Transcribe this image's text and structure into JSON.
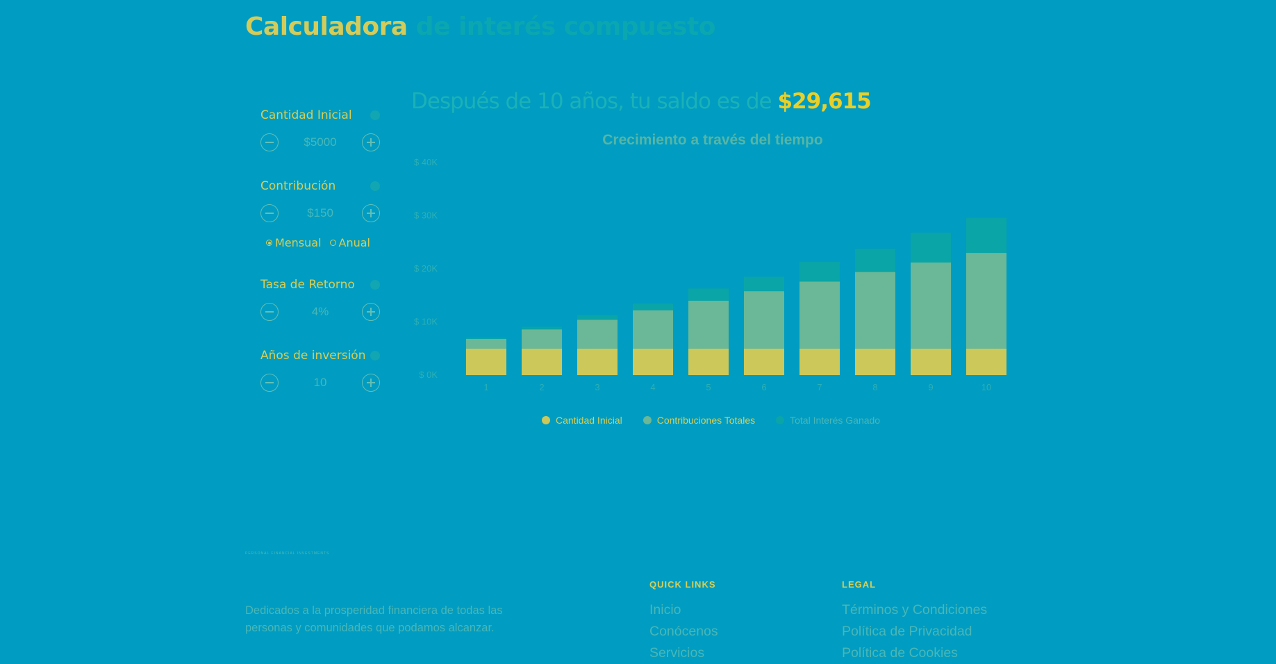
{
  "header": {
    "title_part1": "Calculadora",
    "title_part2": "de interés compuesto"
  },
  "controls": [
    {
      "label": "Cantidad Inicial",
      "value": "$5000"
    },
    {
      "label": "Contribución",
      "value": "$150",
      "frequency": [
        "Mensual",
        "Anual"
      ],
      "selected": "Mensual"
    },
    {
      "label": "Tasa de Retorno",
      "value": "4%"
    },
    {
      "label": "Años de inversión",
      "value": "10"
    }
  ],
  "result": {
    "text": "Después de 10 años, tu saldo es de",
    "amount": "$29,615"
  },
  "chart_data": {
    "type": "bar",
    "stacked": true,
    "title": "Crecimiento a través del tiempo",
    "categories": [
      "1",
      "2",
      "3",
      "4",
      "5",
      "6",
      "7",
      "8",
      "9",
      "10"
    ],
    "y_ticks": [
      "$ 0K",
      "$ 10K",
      "$ 20K",
      "$ 30K",
      "$ 40K"
    ],
    "ylim": [
      0,
      40000
    ],
    "series": [
      {
        "name": "Cantidad Inicial",
        "color": "#ccc85a",
        "values": [
          5000,
          5000,
          5000,
          5000,
          5000,
          5000,
          5000,
          5000,
          5000,
          5000
        ]
      },
      {
        "name": "Contribuciones Totales",
        "color": "#6ab897",
        "values": [
          1800,
          3600,
          5400,
          7200,
          9000,
          10800,
          12600,
          14400,
          16200,
          18000
        ]
      },
      {
        "name": "Total Interés Ganado",
        "color": "#0aa5a7",
        "values": [
          300,
          500,
          900,
          1300,
          2300,
          2700,
          3700,
          4400,
          5600,
          6600
        ]
      }
    ],
    "legend": "bottom"
  },
  "footer": {
    "tagline": "PERSONAL FINANCIAL INVESTMENTS",
    "description": "Dedicados a la prosperidad financiera de todas las personas y comunidades que podamos alcanzar.",
    "quick_links": {
      "title": "QUICK LINKS",
      "items": [
        "Inicio",
        "Conócenos",
        "Servicios"
      ]
    },
    "legal": {
      "title": "LEGAL",
      "items": [
        "Términos y Condiciones",
        "Política de Privacidad",
        "Política de Cookies"
      ]
    }
  }
}
